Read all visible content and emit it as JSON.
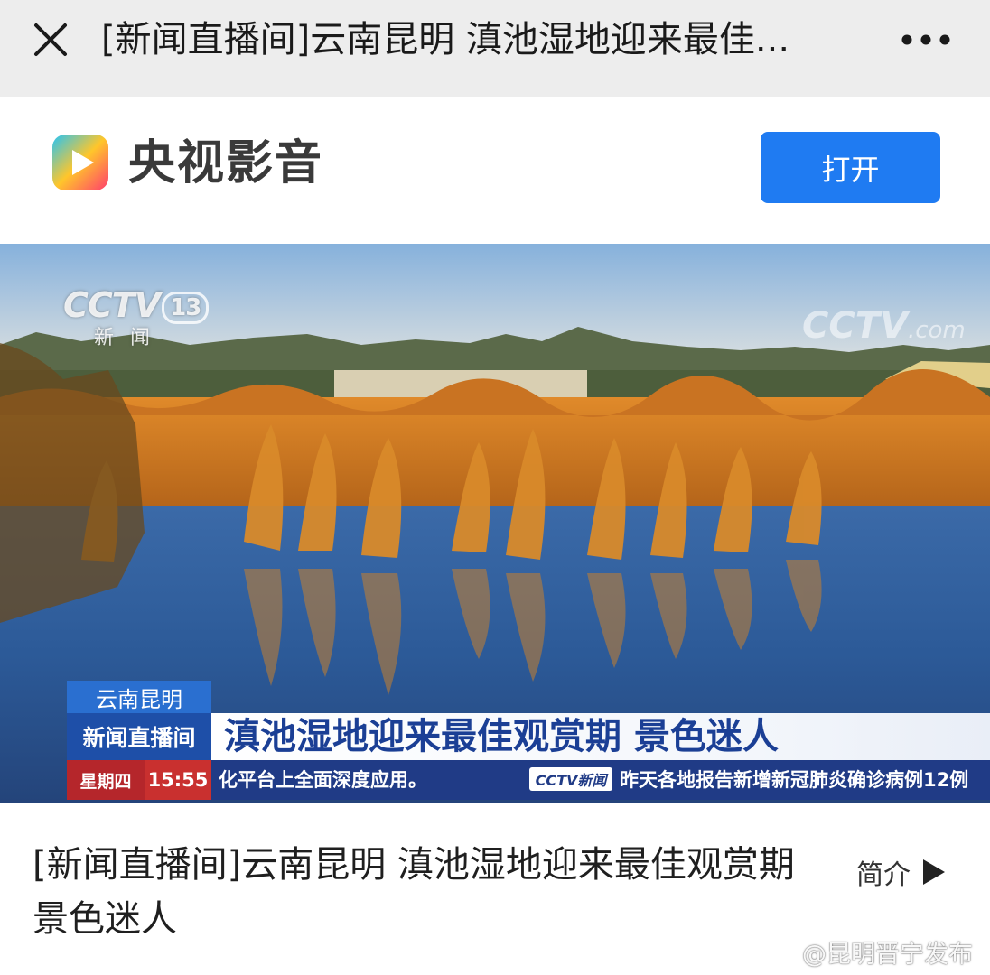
{
  "nav": {
    "title": "[新闻直播间]云南昆明 滇池湿地迎来最佳...",
    "close_icon": "close-icon",
    "more_icon": "more-icon"
  },
  "banner": {
    "app_name": "央视影音",
    "open_label": "打开",
    "logo_icon": "app-logo-icon",
    "accent": "#1f7bf2"
  },
  "video": {
    "channel_logo": "CCTV",
    "channel_number": "13",
    "channel_sub": "新闻",
    "watermark": "CCTV",
    "watermark_suffix": ".com",
    "lower_third": {
      "location": "云南昆明",
      "program": "新闻直播间",
      "headline": "滇池湿地迎来最佳观赏期 景色迷人",
      "day": "星期四",
      "time": "15:55",
      "ticker_left": "化平台上全面深度应用。",
      "ticker_logo": "CCTV新闻",
      "ticker_right": "昨天各地报告新增新冠肺炎确诊病例12例"
    }
  },
  "details": {
    "title": "[新闻直播间]云南昆明 滇池湿地迎来最佳观赏期 景色迷人",
    "intro_label": "简介",
    "intro_icon": "play-arrow-icon"
  },
  "watermark": {
    "text": "@昆明晋宁发布",
    "icon": "weibo-eye-icon"
  }
}
